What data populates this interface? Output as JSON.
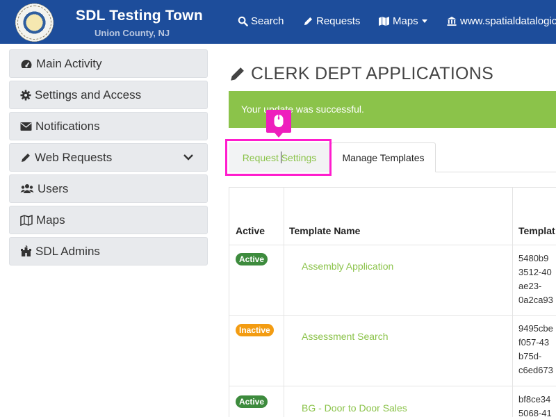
{
  "header": {
    "title": "SDL Testing Town",
    "subtitle": "Union County, NJ",
    "nav": {
      "search": "Search",
      "requests": "Requests",
      "maps": "Maps",
      "site": "www.spatialdatalogic"
    }
  },
  "sidebar": {
    "items": [
      {
        "label": "Main Activity"
      },
      {
        "label": "Settings and Access"
      },
      {
        "label": "Notifications"
      },
      {
        "label": "Web Requests"
      },
      {
        "label": "Users"
      },
      {
        "label": "Maps"
      },
      {
        "label": "SDL Admins"
      }
    ]
  },
  "main": {
    "title": "CLERK DEPT APPLICATIONS",
    "alert": "Your update was successful.",
    "tabs": [
      {
        "label": "Request Settings"
      },
      {
        "label": "Manage Templates"
      }
    ],
    "table": {
      "headers": [
        "Active",
        "Template Name",
        "Templat"
      ],
      "rows": [
        {
          "status": "Active",
          "name": "Assembly Application",
          "id_lines": [
            "5480b9",
            "3512-40",
            "ae23-",
            "0a2ca93"
          ]
        },
        {
          "status": "Inactive",
          "name": "Assessment Search",
          "id_lines": [
            "9495cbe",
            "f057-43",
            "b75d-",
            "c6ed673"
          ]
        },
        {
          "status": "Active",
          "name": "BG - Door to Door Sales",
          "id_lines": [
            "bf8ce34",
            "5068-41"
          ]
        }
      ]
    }
  },
  "colors": {
    "header_bg": "#1d4d9b",
    "accent_green": "#8bc34a",
    "active_badge": "#3d8b3d",
    "inactive_badge": "#f39c12",
    "highlight": "#ff1ccd"
  }
}
